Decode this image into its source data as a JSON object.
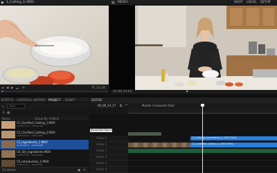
{
  "topbar": {
    "left_tab": "1_Cutting_Cr.MOV",
    "right_tab_icon": "grid-icon",
    "right_label": "MEDIA",
    "left_badge": "5",
    "right_items": [
      "SHOT",
      "LOCAL",
      "SETUP"
    ]
  },
  "left_viewer": {
    "timecode_right": "TC 12:34",
    "frame_label": "01:00"
  },
  "right_viewer": {
    "status_bar_text": "01:00:14:03"
  },
  "project": {
    "tabs": [
      "EFFECTS",
      "CONTROLS",
      "HISTORY",
      "PROJECT",
      "SCRIPT"
    ],
    "search_placeholder": "Filter",
    "column_headers": [
      "Name",
      "Group By: Folders"
    ],
    "items": [
      {
        "name": "C1_Clarified_Cutting_1.MOV",
        "sub": "00:00:12:14 · 1920x1080"
      },
      {
        "name": "C2_Clarified_Cutting_2.MOV",
        "sub": "00:00:09:02 · 1920x1080"
      },
      {
        "name": "C3_Ingredients_1.MOV",
        "sub": "00:00:08:11 · 1920x1080"
      },
      {
        "name": "C4_Stir_Ingredients.MOV",
        "sub": "00:00:07:05 · 1920x1080"
      },
      {
        "name": "C5_Introduction_1.MOV",
        "sub": "00:00:05:22 · 1920x1080"
      }
    ],
    "footer_count": "11 items"
  },
  "timeline": {
    "tab_label": "EDITOR",
    "timecode": "00_00_12_17",
    "comp_label": "Master Composite Shot",
    "ruler_label": "Record Edit Track All",
    "tracks": [
      "Video 2",
      "Video 1",
      "Audio 1",
      "Audio 2",
      "Audio 3",
      "Audio 4"
    ],
    "clip_label_1": "C4_Stirring_Ingredients_1_SHOT.MOV",
    "clip_label_2": "C2_Clarified_Cutting_1_SHOT.MOV"
  },
  "colors": {
    "accent": "#2f7be6",
    "selection": "#1e4f9a",
    "clip_video": "#3e5d44",
    "clip_audio": "#2a7fdc"
  }
}
